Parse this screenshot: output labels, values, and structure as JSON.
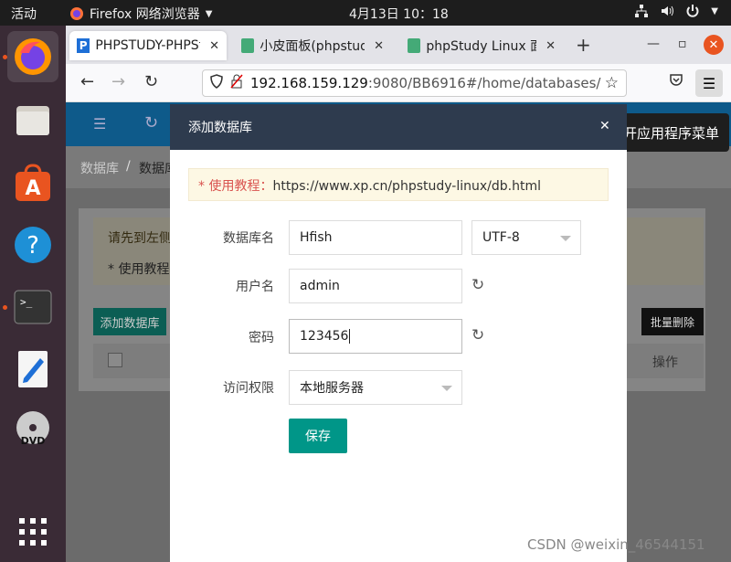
{
  "topbar": {
    "activities": "活动",
    "app_name": "Firefox 网络浏览器",
    "clock": "4月13日  10：18"
  },
  "browser": {
    "tabs": [
      {
        "label": "PHPSTUDY-PHPStu"
      },
      {
        "label": "小皮面板(phpstudy"
      },
      {
        "label": "phpStudy Linux 面板"
      }
    ],
    "url_host": "192.168.159.129",
    "url_rest": ":9080/BB6916#/home/databases/"
  },
  "page": {
    "breadcrumb_root": "数据库",
    "breadcrumb_sep": "/",
    "breadcrumb_current": "数据库",
    "notice_line1": "请先到左侧",
    "notice_line2": "* 使用教程",
    "add_button": "添加数据库",
    "bulk_delete_button": "批量删除",
    "col_actions": "操作"
  },
  "tooltip": "打开应用程序菜单",
  "modal": {
    "title": "添加数据库",
    "tip_prefix": "* 使用教程：",
    "tip_url": "https://www.xp.cn/phpstudy-linux/db.html",
    "db_name_label": "数据库名",
    "db_name_value": "Hfish",
    "charset_value": "UTF-8",
    "username_label": "用户名",
    "username_value": "admin",
    "password_label": "密码",
    "password_value": "123456",
    "access_label": "访问权限",
    "access_value": "本地服务器",
    "save_button": "保存"
  },
  "watermark": "CSDN @weixin_46544151",
  "colors": {
    "accent": "#009688",
    "modal_header": "#2e3b4e",
    "ubuntu_orange": "#e95420"
  }
}
